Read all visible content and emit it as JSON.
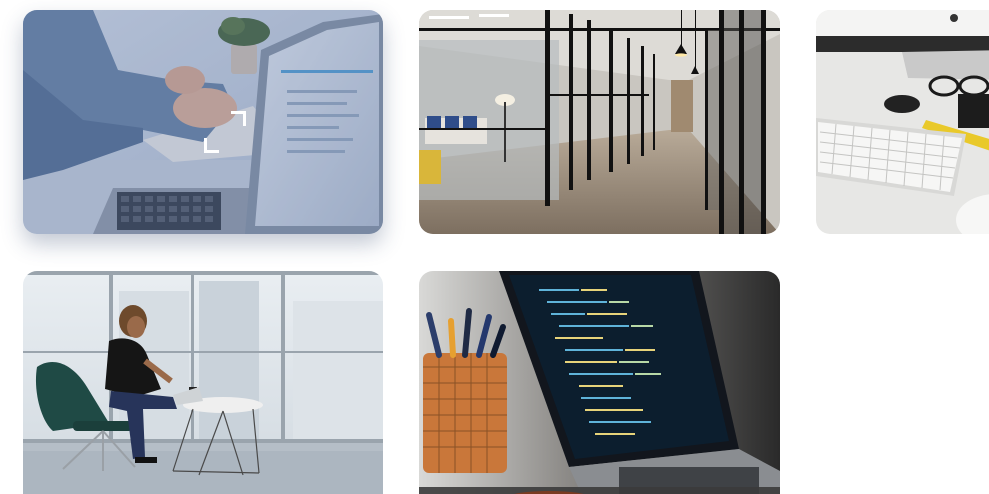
{
  "gallery": {
    "images": [
      {
        "subject": "hands-on-laptop-desk",
        "state": "hovered"
      },
      {
        "subject": "glass-office-corridor",
        "state": "default"
      },
      {
        "subject": "keyboard-and-glasses-desk",
        "state": "default"
      },
      {
        "subject": "woman-working-in-lounge-chair",
        "state": "default"
      },
      {
        "subject": "code-on-laptop-screen",
        "state": "default"
      }
    ]
  },
  "icons": {
    "focus": "focus-frame-icon",
    "cursor": "hand-pointer-icon"
  },
  "colors": {
    "hover_overlay": "#465f96",
    "focus_frame": "#ffffff",
    "background": "#ffffff"
  }
}
